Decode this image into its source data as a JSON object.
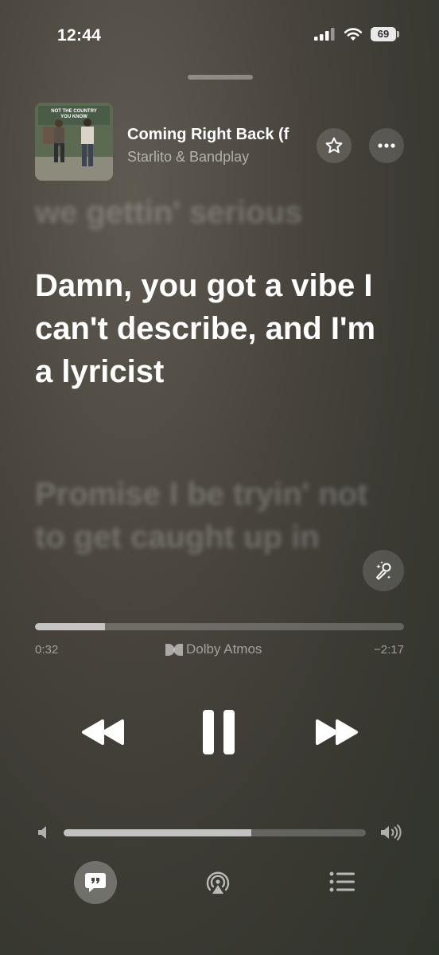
{
  "status_bar": {
    "time": "12:44",
    "battery": "69"
  },
  "now_playing": {
    "title": "Coming Right Back (f",
    "artist": "Starlito & Bandplay",
    "artwork_text": "NOT THE COUNTRY YOU KNOW"
  },
  "lyrics": {
    "previous": "we gettin' serious",
    "current": "Damn, you got a vibe I can't describe, and I'm a lyricist",
    "next": "Promise I be tryin' not to get caught up in"
  },
  "playback": {
    "elapsed": "0:32",
    "remaining": "−2:17",
    "progress_fraction": 0.19,
    "audio_format": "Dolby Atmos"
  },
  "volume": {
    "level_fraction": 0.62
  },
  "icons": {
    "favorite": "star-icon",
    "more": "ellipsis-icon",
    "sing": "microphone-sparkle-icon",
    "rewind": "rewind-icon",
    "pause": "pause-icon",
    "forward": "fast-forward-icon",
    "lyrics": "quote-bubble-icon",
    "airplay": "airplay-icon",
    "queue": "list-icon"
  },
  "colors": {
    "accent": "#ffffff",
    "background": "#47443c"
  }
}
